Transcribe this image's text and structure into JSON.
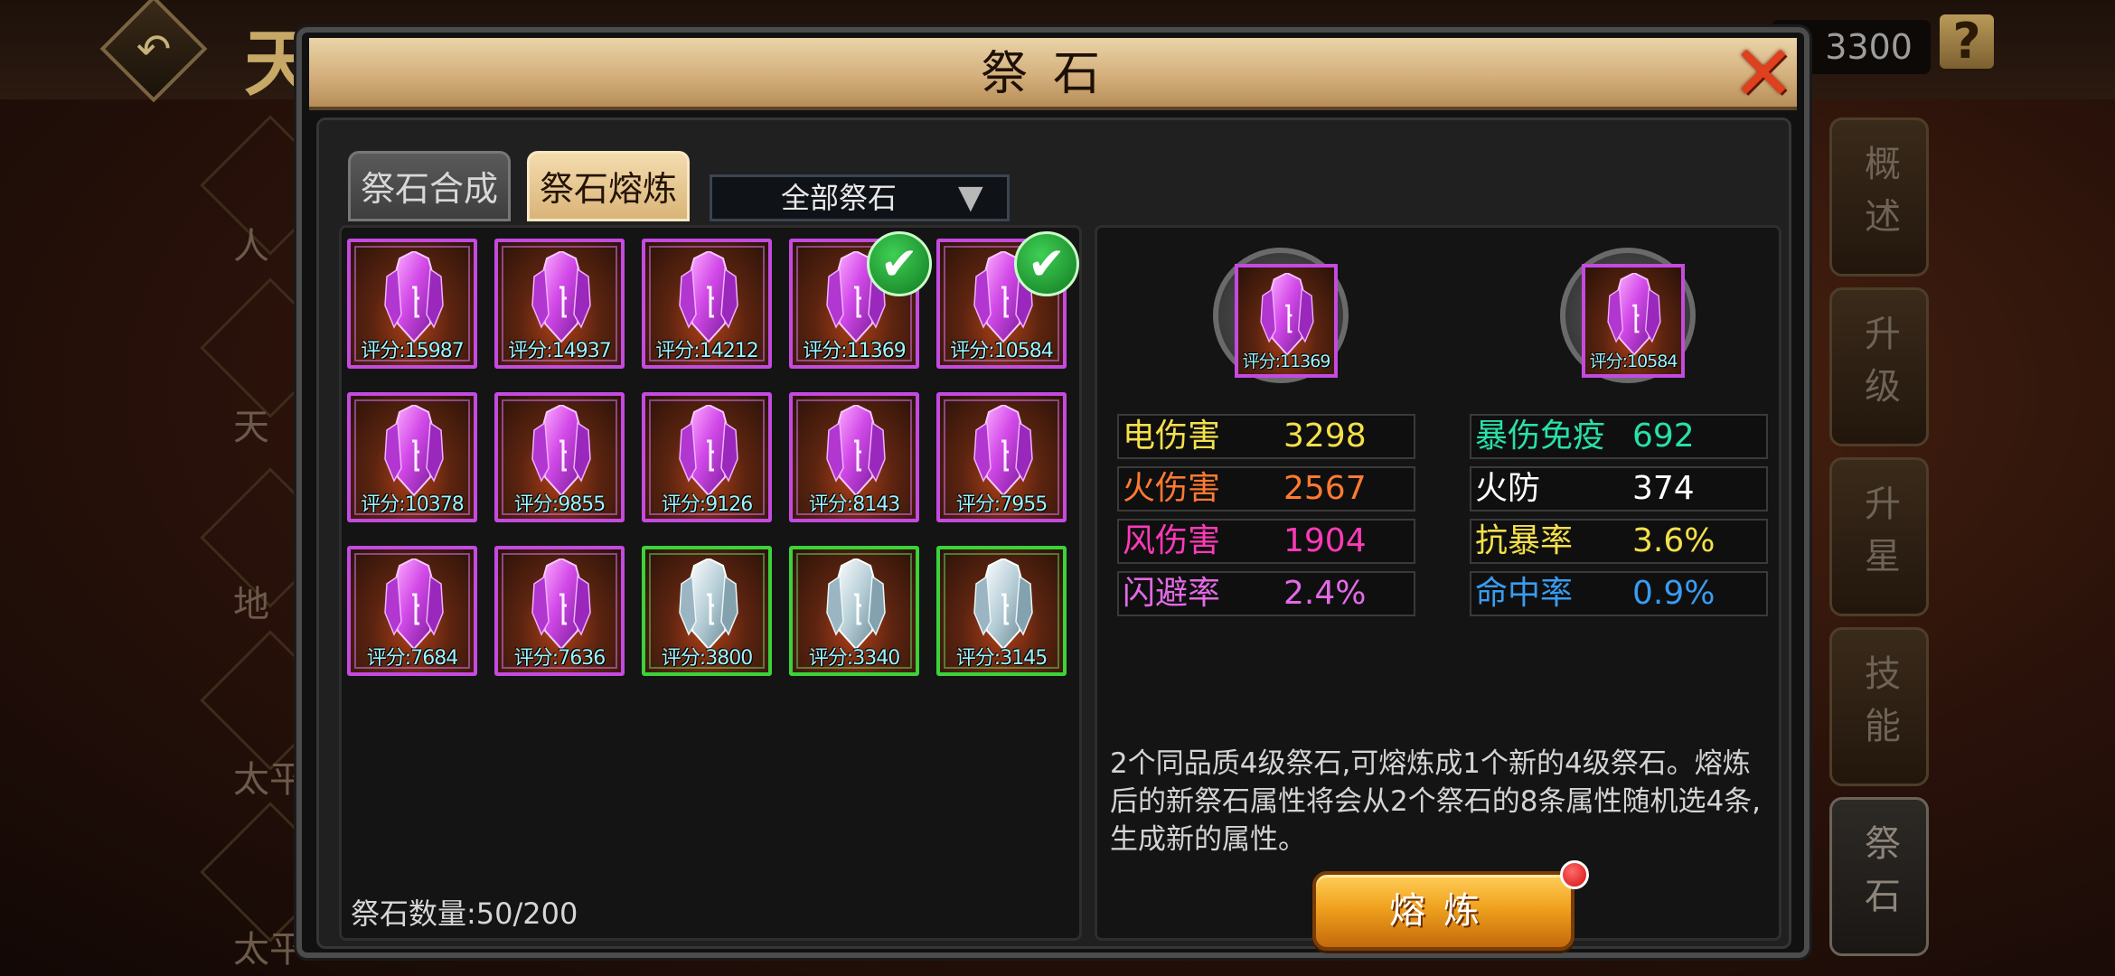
{
  "background": {
    "title_char": "天",
    "currency_value": "3300",
    "help_icon": "?",
    "left_labels": [
      "人",
      "天",
      "地",
      "太平",
      "太平"
    ],
    "side_tabs": [
      {
        "label": "概述",
        "active": false
      },
      {
        "label": "升级",
        "active": false
      },
      {
        "label": "升星",
        "active": false
      },
      {
        "label": "技能",
        "active": false
      },
      {
        "label": "祭石",
        "active": true
      }
    ]
  },
  "modal": {
    "title": "祭石",
    "close_icon": "✕"
  },
  "tabs": {
    "compose": "祭石合成",
    "smelt": "祭石熔炼"
  },
  "filter": {
    "value": "全部祭石",
    "caret": "▼"
  },
  "gems": [
    {
      "score": "评分:15987",
      "quality": "purple",
      "selected": false
    },
    {
      "score": "评分:14937",
      "quality": "purple",
      "selected": false
    },
    {
      "score": "评分:14212",
      "quality": "purple",
      "selected": false
    },
    {
      "score": "评分:11369",
      "quality": "purple",
      "selected": true
    },
    {
      "score": "评分:10584",
      "quality": "purple",
      "selected": true
    },
    {
      "score": "评分:10378",
      "quality": "purple",
      "selected": false
    },
    {
      "score": "评分:9855",
      "quality": "purple",
      "selected": false
    },
    {
      "score": "评分:9126",
      "quality": "purple",
      "selected": false
    },
    {
      "score": "评分:8143",
      "quality": "purple",
      "selected": false
    },
    {
      "score": "评分:7955",
      "quality": "purple",
      "selected": false
    },
    {
      "score": "评分:7684",
      "quality": "purple",
      "selected": false
    },
    {
      "score": "评分:7636",
      "quality": "purple",
      "selected": false
    },
    {
      "score": "评分:3800",
      "quality": "green",
      "selected": false
    },
    {
      "score": "评分:3340",
      "quality": "green",
      "selected": false
    },
    {
      "score": "评分:3145",
      "quality": "green",
      "selected": false
    }
  ],
  "check_icon": "✔",
  "gem_count": "祭石数量:50/200",
  "slots": [
    {
      "score": "评分:11369"
    },
    {
      "score": "评分:10584"
    }
  ],
  "stats_left": [
    {
      "name": "电伤害",
      "value": "3298",
      "name_color": "#f4e04a",
      "value_color": "#f4e04a"
    },
    {
      "name": "火伤害",
      "value": "2567",
      "name_color": "#ff7a32",
      "value_color": "#ff7a32"
    },
    {
      "name": "风伤害",
      "value": "1904",
      "name_color": "#ff3ab8",
      "value_color": "#ff3ab8"
    },
    {
      "name": "闪避率",
      "value": "2.4%",
      "name_color": "#e36ae6",
      "value_color": "#e36ae6"
    }
  ],
  "stats_right": [
    {
      "name": "暴伤免疫",
      "value": "692",
      "name_color": "#28e0a8",
      "value_color": "#28e0a8"
    },
    {
      "name": "火防",
      "value": "374",
      "name_color": "#ffffff",
      "value_color": "#ffffff"
    },
    {
      "name": "抗暴率",
      "value": "3.6%",
      "name_color": "#f4e04a",
      "value_color": "#f4e04a"
    },
    {
      "name": "命中率",
      "value": "0.9%",
      "name_color": "#3a9cf0",
      "value_color": "#3a9cf0"
    }
  ],
  "description": "2个同品质4级祭石,可熔炼成1个新的4级祭石。熔炼后的新祭石属性将会从2个祭石的8条属性随机选4条,生成新的属性。",
  "smelt_button": "熔炼"
}
